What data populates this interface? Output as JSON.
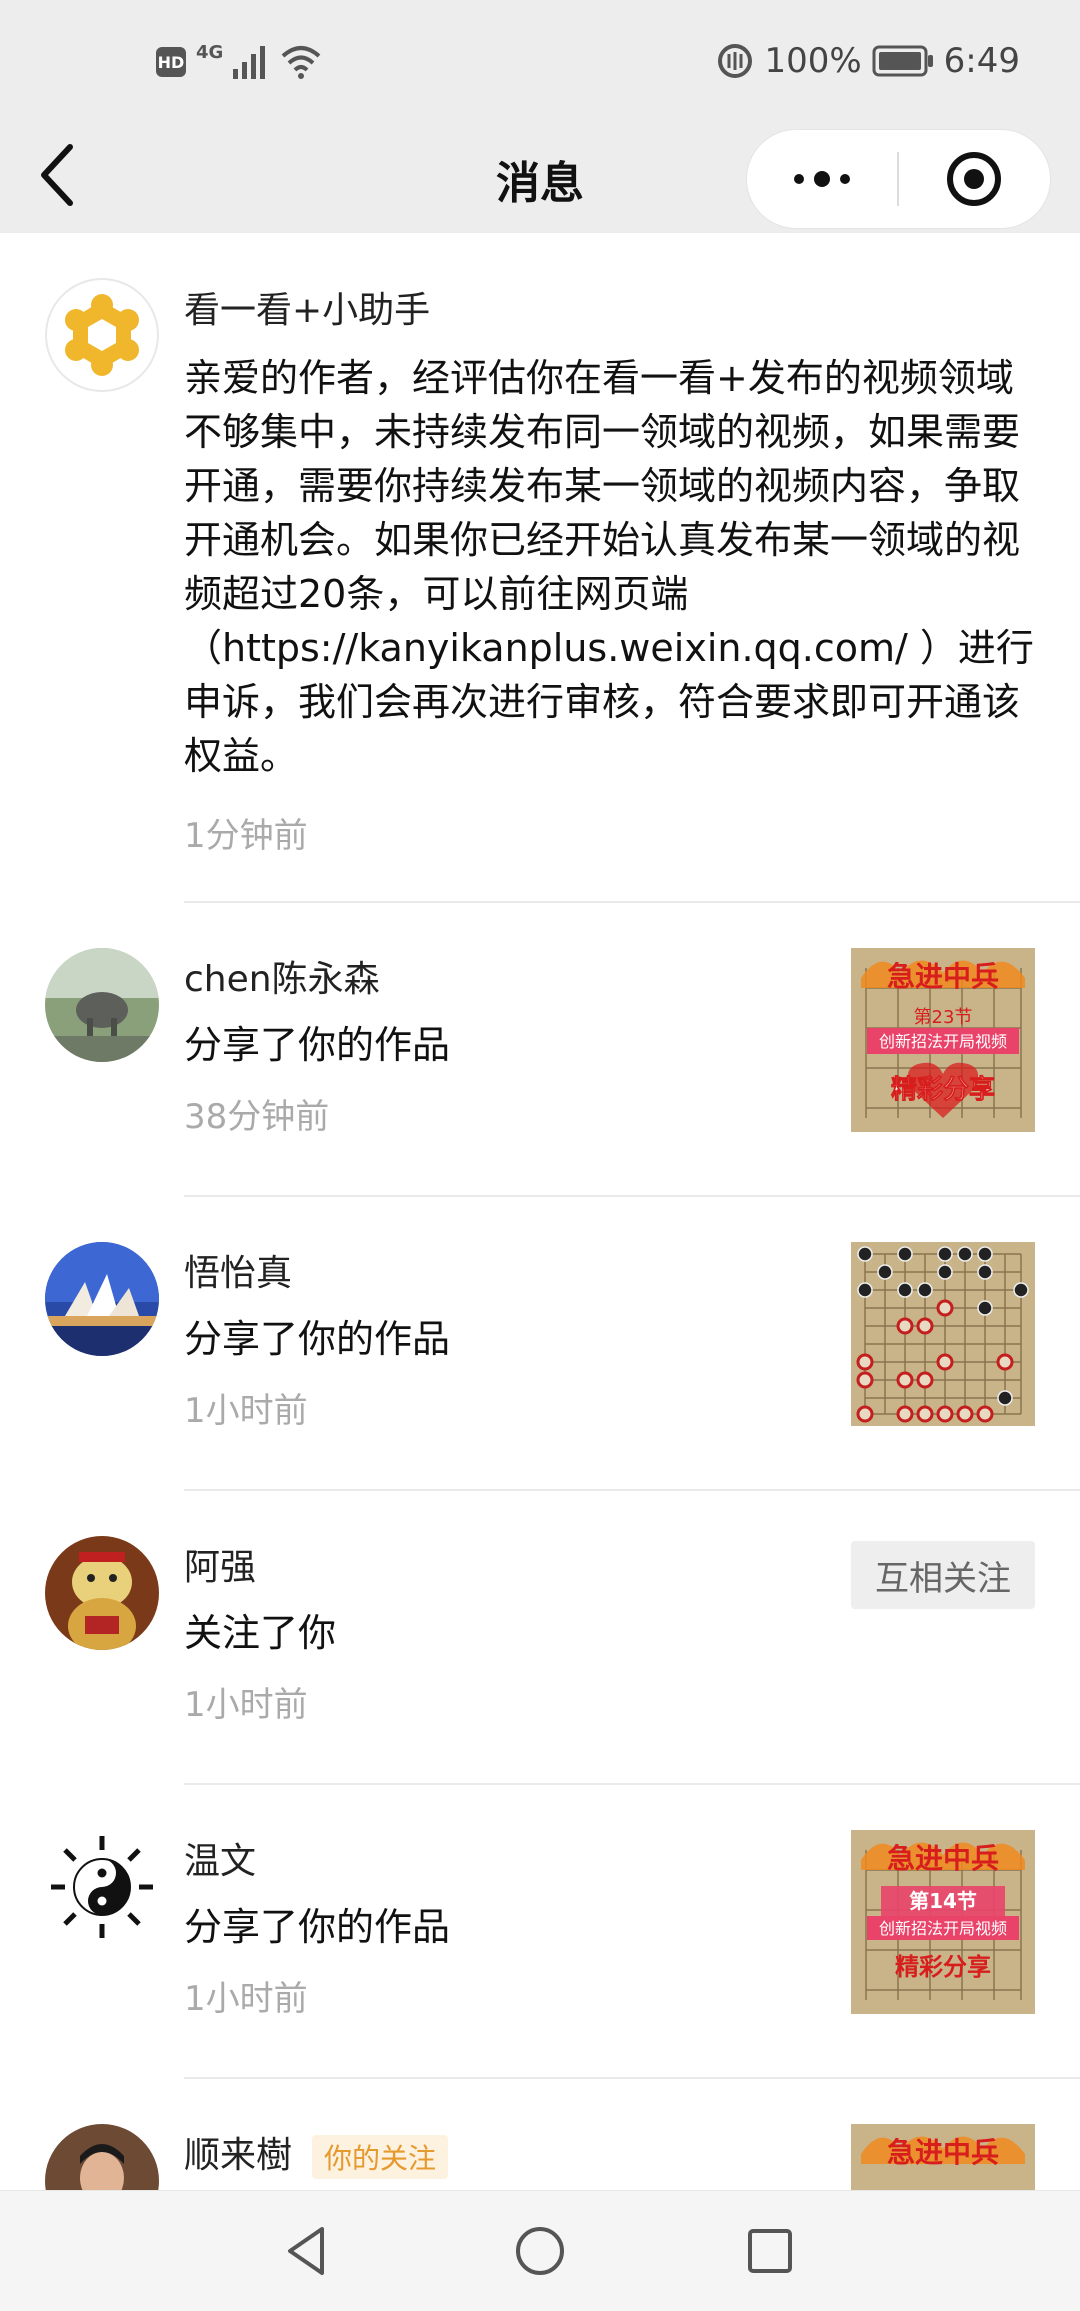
{
  "status_bar": {
    "hd": "HD",
    "network": "4G",
    "battery": "100%",
    "time": "6:49"
  },
  "header": {
    "title": "消息"
  },
  "messages": [
    {
      "name": "看一看+小助手",
      "content": "亲爱的作者，经评估你在看一看+发布的视频领域不够集中，未持续发布同一领域的视频，如果需要开通，需要你持续发布某一领域的视频内容，争取开通机会。如果你已经开始认真发布某一领域的视频超过20条，可以前往网页端（https://kanyikanplus.weixin.qq.com/ ）进行申诉，我们会再次进行审核，符合要求即可开通该权益。",
      "time": "1分钟前"
    },
    {
      "name": "chen陈永森",
      "content": "分享了你的作品",
      "time": "38分钟前",
      "thumb": {
        "title": "急进中兵",
        "episode": "第23节",
        "subtitle": "创新招法开局视频",
        "footer": "精彩分享"
      }
    },
    {
      "name": "悟怡真",
      "content": "分享了你的作品",
      "time": "1小时前"
    },
    {
      "name": "阿强",
      "content": "关注了你",
      "time": "1小时前",
      "action": "互相关注"
    },
    {
      "name": "温文",
      "content": "分享了你的作品",
      "time": "1小时前",
      "thumb": {
        "title": "急进中兵",
        "episode": "第14节",
        "subtitle": "创新招法开局视频",
        "footer": "精彩分享"
      }
    },
    {
      "name": "顺来樹",
      "tag": "你的关注",
      "thumb": {
        "title": "急进中兵"
      }
    }
  ],
  "colors": {
    "bar_bg": "#ededed",
    "time_text": "#aaaaaa",
    "tag_text": "#e59a2e",
    "tag_bg": "#fdf1e0",
    "board": "#c9b48a"
  }
}
